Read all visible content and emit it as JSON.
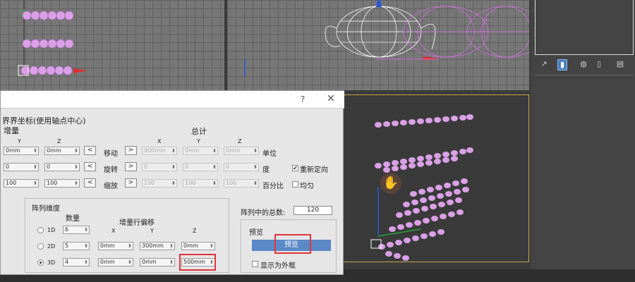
{
  "dialog": {
    "help": "?",
    "close": "✕",
    "coord_header": "界界坐标(使用轴点中心)",
    "incremental": "增量",
    "totals": "总计",
    "axes": {
      "x": "X",
      "y": "Y",
      "z": "Z"
    },
    "move_label": "移动",
    "rotate_label": "旋转",
    "scale_label": "缩放",
    "move_arrow_left": "<",
    "move_arrow_right": ">",
    "units_label": "单位",
    "degrees_label": "度",
    "percent_label": "百分比",
    "reorient_label": "重新定向",
    "reorient_checked": "✔",
    "uniform_label": "均匀",
    "inc_move": {
      "y": "0mm",
      "z": "0mm"
    },
    "inc_rotate": {
      "y": "0",
      "z": "0"
    },
    "inc_scale": {
      "y": "100",
      "z": "100"
    },
    "tot_move": {
      "x": "900mm",
      "y": "0mm",
      "z": "0mm"
    },
    "tot_rotate": {
      "x": "0",
      "y": "0",
      "z": "0"
    },
    "tot_scale": {
      "x": "100",
      "y": "100",
      "z": "100"
    },
    "array_dims": "阵列维度",
    "count_label": "数量",
    "inc_row_offset": "增量行偏移",
    "dim_1d": "1D",
    "dim_2d": "2D",
    "dim_3d": "3D",
    "count_1d": "6",
    "count_2d": "5",
    "count_3d": "4",
    "row2d": {
      "x": "0mm",
      "y": "300mm",
      "z": "0mm"
    },
    "row3d": {
      "x": "0mm",
      "y": "0mm",
      "z": "500mm"
    },
    "total_in_array_label": "阵列中的总数:",
    "total_in_array": "120",
    "preview_group": "预览",
    "preview_button": "预览",
    "show_as_box": "显示为外框"
  },
  "colors": {
    "accent": "#5b88c6",
    "highlight": "#e0343a",
    "objects": "#d8a6e8"
  }
}
